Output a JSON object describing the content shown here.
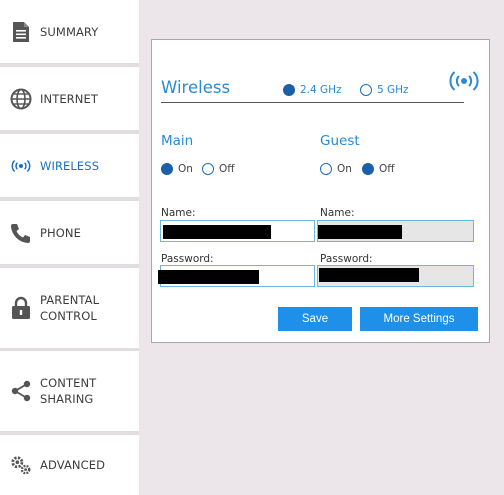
{
  "sidebar": {
    "items": [
      {
        "id": "summary",
        "label": "SUMMARY",
        "icon": "document-icon"
      },
      {
        "id": "internet",
        "label": "INTERNET",
        "icon": "globe-icon"
      },
      {
        "id": "wireless",
        "label": "WIRELESS",
        "icon": "wifi-signal-icon",
        "active": true
      },
      {
        "id": "phone",
        "label": "PHONE",
        "icon": "phone-icon"
      },
      {
        "id": "parental",
        "label": "PARENTAL CONTROL",
        "icon": "lock-icon"
      },
      {
        "id": "sharing",
        "label": "CONTENT SHARING",
        "icon": "share-icon"
      },
      {
        "id": "advanced",
        "label": "ADVANCED",
        "icon": "gears-icon"
      }
    ]
  },
  "wireless": {
    "title": "Wireless",
    "band_24": "2.4 GHz",
    "band_5": "5 GHz",
    "selected_band": "2.4 GHz",
    "main": {
      "heading": "Main",
      "on_label": "On",
      "off_label": "Off",
      "state": "On",
      "name_label": "Name:",
      "password_label": "Password:"
    },
    "guest": {
      "heading": "Guest",
      "on_label": "On",
      "off_label": "Off",
      "state": "Off",
      "name_label": "Name:",
      "password_label": "Password:"
    },
    "save_label": "Save",
    "more_settings_label": "More Settings"
  },
  "colors": {
    "accent": "#2a8ad4",
    "button": "#1e90ea",
    "background": "#ece6ea"
  }
}
